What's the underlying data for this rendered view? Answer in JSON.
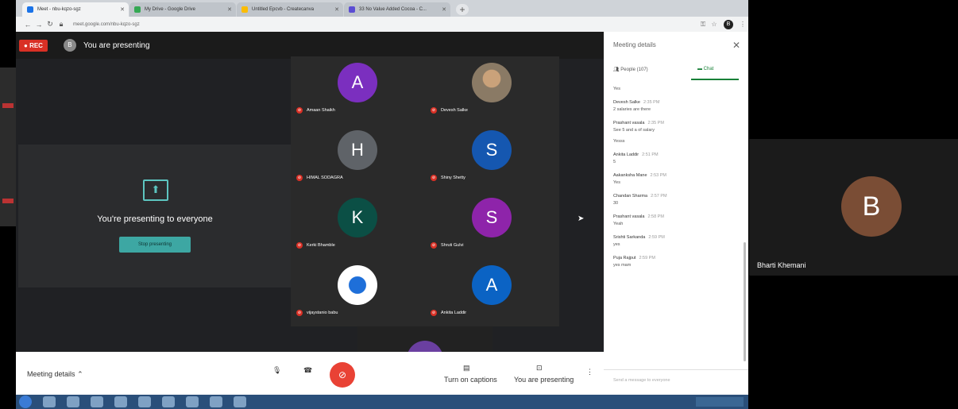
{
  "browser": {
    "tabs": [
      {
        "label": "Meet - nbu-kqzo-sgz",
        "color": "#1a73e8",
        "active": true
      },
      {
        "label": "My Drive - Google Drive",
        "color": "#34a853",
        "active": false
      },
      {
        "label": "Untitled Epcvb - Createcanva",
        "color": "#fbbc04",
        "active": false
      },
      {
        "label": "33 No Value Added Cocoa - C...",
        "color": "#5b4dd3",
        "active": false
      }
    ],
    "url": "meet.google.com/nbu-kqzo-sgz",
    "profile_initial": "B",
    "icons": {
      "back": "arrow-left",
      "forward": "arrow-right",
      "reload": "reload",
      "lock": "lock",
      "star": "star",
      "new_tab": "plus"
    }
  },
  "meet": {
    "rec_label": "REC",
    "presenter_initial": "B",
    "presenting_label": "You are presenting",
    "present_card": {
      "message": "You're presenting to everyone",
      "stop_button": "Stop presenting"
    },
    "participants": [
      {
        "initial": "A",
        "name": "Amaan Shaikh",
        "color": "#7b2fbf",
        "photo": false
      },
      {
        "initial": "",
        "name": "Devesh Salke",
        "color": "#8a7a65",
        "photo": true
      },
      {
        "initial": "H",
        "name": "HIMAL SODAGRA",
        "color": "#5f6368",
        "photo": false
      },
      {
        "initial": "S",
        "name": "Shiny Shetty",
        "color": "#1557b0",
        "photo": false
      },
      {
        "initial": "K",
        "name": "Kerki Bhamble",
        "color": "#0b4f45",
        "photo": false
      },
      {
        "initial": "S",
        "name": "Shruti Gulvi",
        "color": "#8e24aa",
        "photo": false
      },
      {
        "initial": "",
        "name": "vijaystanio babu",
        "color": "#ffffff",
        "photo": true
      },
      {
        "initial": "A",
        "name": "Ankita Laddir",
        "color": "#0b63c4",
        "photo": false
      }
    ],
    "bottom_bar": {
      "meeting_details": "Meeting details",
      "captions_label": "Turn on captions",
      "presenting_label": "You are presenting"
    },
    "panel": {
      "title": "Meeting details",
      "people_tab": "People (107)",
      "chat_tab": "Chat",
      "messages": [
        {
          "sender": "",
          "time": "",
          "text": "Yes",
          "text2": ""
        },
        {
          "sender": "Devesh Salke",
          "time": "2:35 PM",
          "text": "2 salaries are there",
          "text2": ""
        },
        {
          "sender": "Prashant vasala",
          "time": "2:35 PM",
          "text": "See 5 and a of salary",
          "text2": "Yesss"
        },
        {
          "sender": "Ankita Laddir",
          "time": "2:51 PM",
          "text": "5",
          "text2": ""
        },
        {
          "sender": "Aakanksha Mane",
          "time": "2:53 PM",
          "text": "Yes",
          "text2": ""
        },
        {
          "sender": "Chandan Sharma",
          "time": "2:57 PM",
          "text": "30",
          "text2": ""
        },
        {
          "sender": "Prashant vasala",
          "time": "2:58 PM",
          "text": "Yeah",
          "text2": ""
        },
        {
          "sender": "Srishti Sarkanda",
          "time": "2:59 PM",
          "text": "yes",
          "text2": ""
        },
        {
          "sender": "Puja Rajput",
          "time": "2:59 PM",
          "text": "yes mam",
          "text2": ""
        }
      ],
      "input_placeholder": "Send a message to everyone"
    }
  },
  "right_tile": {
    "initial": "B",
    "name": "Bharti Khemani",
    "color": "#7a4d35"
  }
}
